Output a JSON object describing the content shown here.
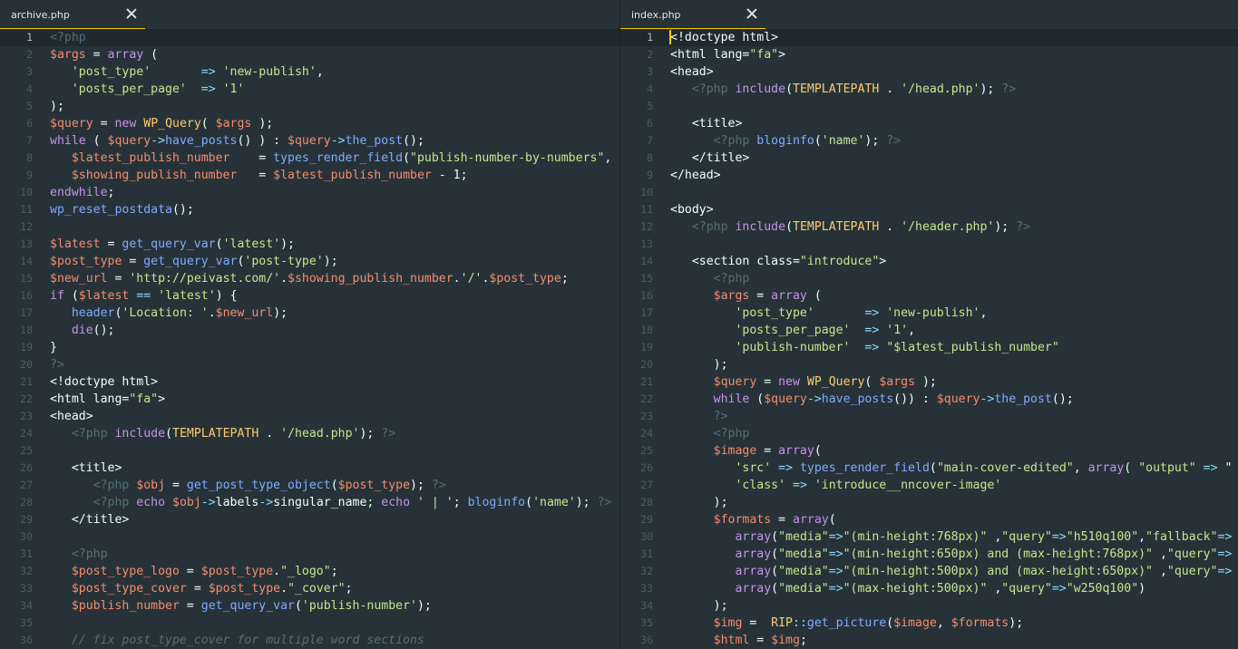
{
  "left": {
    "tab": {
      "name": "archive.php"
    },
    "lines": [
      "<?php",
      "$args = array (",
      "   'post_type'       => 'new-publish',",
      "   'posts_per_page'  => '1'",
      ");",
      "$query = new WP_Query( $args );",
      "while ( $query->have_posts() ) : $query->the_post();",
      "   $latest_publish_number    = types_render_field(\"publish-number-by-numbers\",",
      "   $showing_publish_number   = $latest_publish_number - 1;",
      "endwhile;",
      "wp_reset_postdata();",
      "",
      "$latest = get_query_var('latest');",
      "$post_type = get_query_var('post-type');",
      "$new_url = 'http://peivast.com/'.$showing_publish_number.'/'.$post_type;",
      "if ($latest == 'latest') {",
      "   header('Location: '.$new_url);",
      "   die();",
      "}",
      "?>",
      "<!doctype html>",
      "<html lang=\"fa\">",
      "<head>",
      "   <?php include(TEMPLATEPATH . '/head.php'); ?>",
      "",
      "   <title>",
      "      <?php $obj = get_post_type_object($post_type); ?>",
      "      <?php echo $obj->labels->singular_name; echo ' | '; bloginfo('name'); ?>",
      "   </title>",
      "",
      "   <?php",
      "   $post_type_logo = $post_type.\"_logo\";",
      "   $post_type_cover = $post_type.\"_cover\";",
      "   $publish_number = get_query_var('publish-number');",
      "",
      "   // fix post_type_cover for multiple word sections"
    ]
  },
  "right": {
    "tab": {
      "name": "index.php"
    },
    "lines": [
      "<!doctype html>",
      "<html lang=\"fa\">",
      "<head>",
      "   <?php include(TEMPLATEPATH . '/head.php'); ?>",
      "",
      "   <title>",
      "      <?php bloginfo('name'); ?>",
      "   </title>",
      "</head>",
      "",
      "<body>",
      "   <?php include(TEMPLATEPATH . '/header.php'); ?>",
      "",
      "   <section class=\"introduce\">",
      "      <?php",
      "      $args = array (",
      "         'post_type'       => 'new-publish',",
      "         'posts_per_page'  => '1',",
      "         'publish-number'  => \"$latest_publish_number\"",
      "      );",
      "      $query = new WP_Query( $args );",
      "      while ($query->have_posts()) : $query->the_post();",
      "      ?>",
      "      <?php",
      "      $image = array(",
      "         'src' => types_render_field(\"main-cover-edited\", array( \"output\" => \"",
      "         'class' => 'introduce__nncover-image'",
      "      );",
      "      $formats = array(",
      "         array(\"media\"=>\"(min-height:768px)\" ,\"query\"=>\"h510q100\",\"fallback\"=>",
      "         array(\"media\"=>\"(min-height:650px) and (max-height:768px)\" ,\"query\"=>",
      "         array(\"media\"=>\"(min-height:500px) and (max-height:650px)\" ,\"query\"=>",
      "         array(\"media\"=>\"(max-height:500px)\" ,\"query\"=>\"w250q100\")",
      "      );",
      "      $img =  RIP::get_picture($image, $formats);",
      "      $html = $img;"
    ]
  }
}
